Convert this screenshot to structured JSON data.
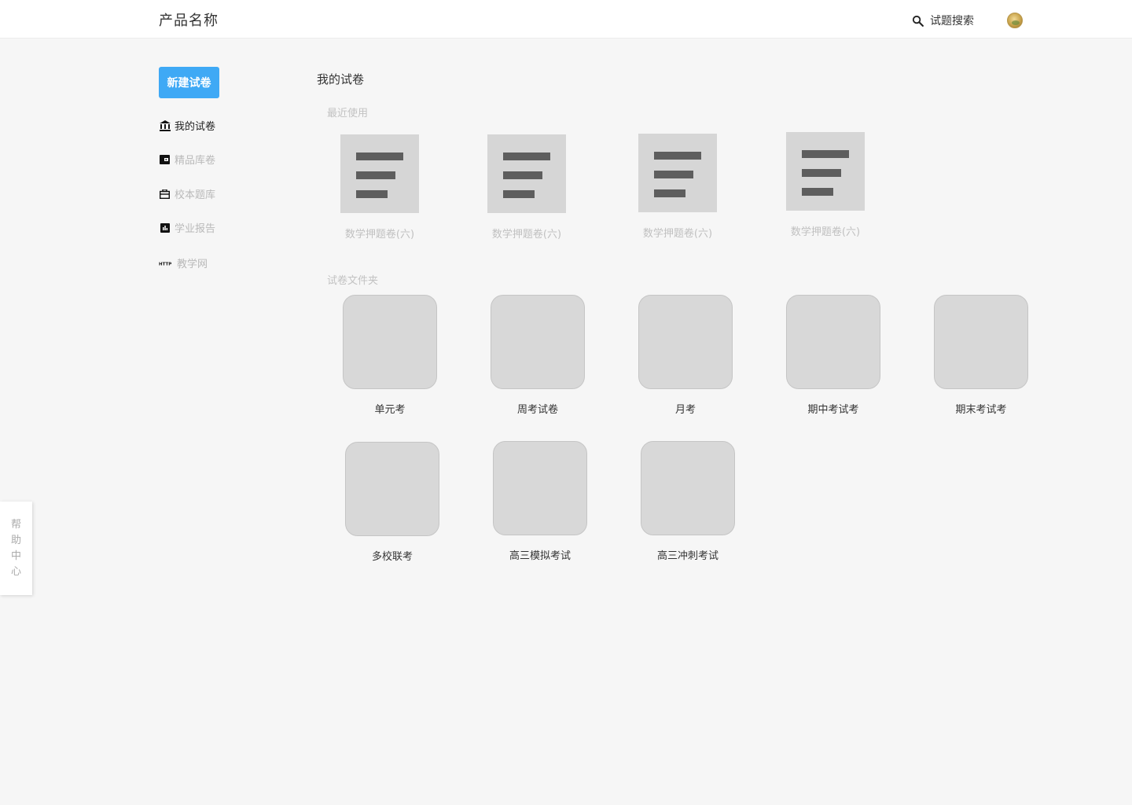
{
  "header": {
    "product_name": "产品名称",
    "search_label": "试题搜索"
  },
  "sidebar": {
    "new_button": "新建试卷",
    "items": [
      {
        "label": "我的试卷",
        "icon": "bank-icon"
      },
      {
        "label": "精品库卷",
        "icon": "wallet-icon"
      },
      {
        "label": "校本题库",
        "icon": "briefcase-icon"
      },
      {
        "label": "学业报告",
        "icon": "report-chart-icon"
      },
      {
        "label": "教学网",
        "icon": "http-icon"
      }
    ]
  },
  "main": {
    "title": "我的试卷",
    "recent_title": "最近使用",
    "recent_papers": [
      {
        "label": "数学押题卷(六)"
      },
      {
        "label": "数学押题卷(六)"
      },
      {
        "label": "数学押题卷(六)"
      },
      {
        "label": "数学押题卷(六)"
      }
    ],
    "folders_title": "试卷文件夹",
    "folders": [
      {
        "label": "单元考"
      },
      {
        "label": "周考试卷"
      },
      {
        "label": "月考"
      },
      {
        "label": "期中考试考"
      },
      {
        "label": "期末考试考"
      },
      {
        "label": "多校联考"
      },
      {
        "label": "高三模拟考试"
      },
      {
        "label": "高三冲刺考试"
      }
    ]
  },
  "help": {
    "chars": [
      "帮",
      "助",
      "中",
      "心"
    ]
  },
  "colors": {
    "accent": "#3fa9f5",
    "placeholder": "#d6d6d6",
    "bar": "#5e5e5e"
  }
}
